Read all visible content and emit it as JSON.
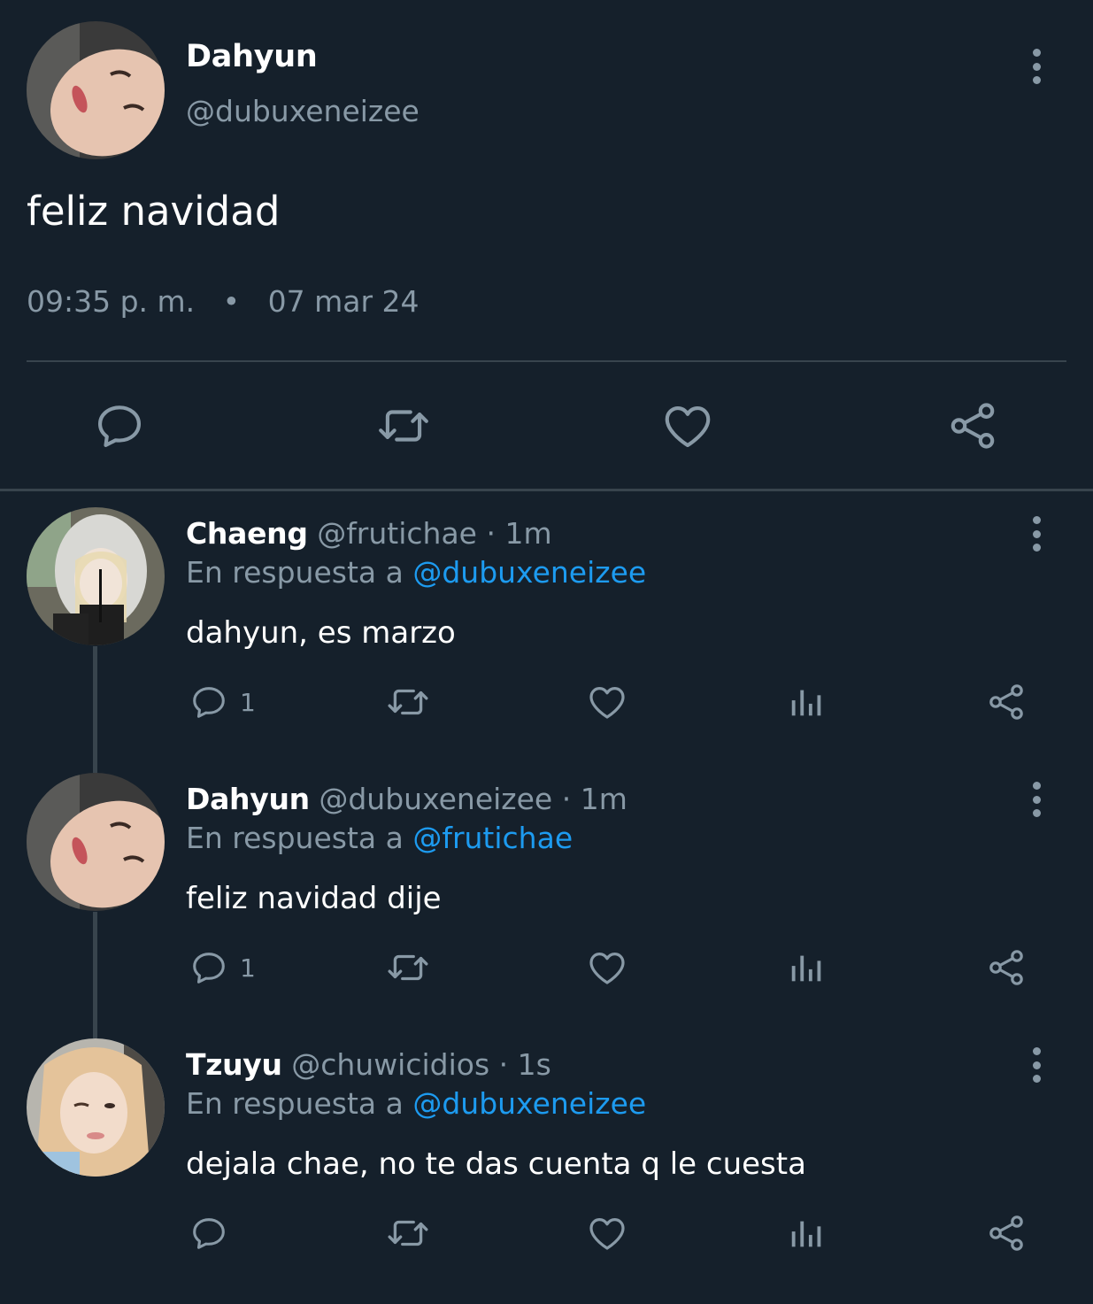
{
  "main_tweet": {
    "author_name": "Dahyun",
    "author_handle": "@dubuxeneizee",
    "text": "feliz navidad",
    "time": "09:35 p. m.",
    "dot": "•",
    "date": "07 mar 24",
    "actions": [
      "reply-icon",
      "retweet-icon",
      "like-icon",
      "share-icon"
    ]
  },
  "replies": [
    {
      "author_name": "Chaeng",
      "author_handle": "@frutichae",
      "age": "· 1m",
      "replying_prefix": "En respuesta a",
      "replying_to": "@dubuxeneizee",
      "text": "dahyun, es marzo",
      "reply_count": "1"
    },
    {
      "author_name": "Dahyun",
      "author_handle": "@dubuxeneizee",
      "age": "· 1m",
      "replying_prefix": "En respuesta a",
      "replying_to": "@frutichae",
      "text": "feliz navidad dije",
      "reply_count": "1"
    },
    {
      "author_name": "Tzuyu",
      "author_handle": "@chuwicidios",
      "age": "· 1s",
      "replying_prefix": "En respuesta a",
      "replying_to": "@dubuxeneizee",
      "text": "dejala chae, no te das cuenta q le cuesta",
      "reply_count": ""
    }
  ],
  "colors": {
    "background": "#15202b",
    "muted_text": "#8899a6",
    "link": "#1d9bf0",
    "divider": "#38444d"
  }
}
